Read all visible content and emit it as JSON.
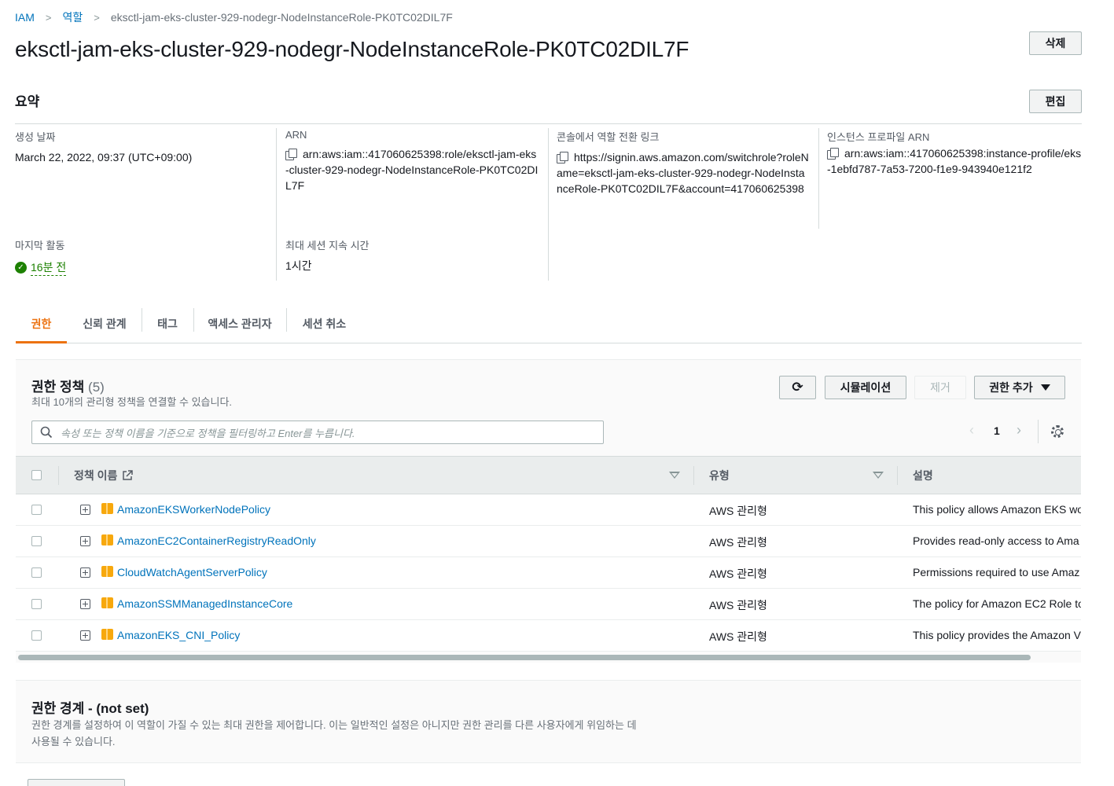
{
  "breadcrumb": {
    "root": "IAM",
    "section": "역할",
    "current": "eksctl-jam-eks-cluster-929-nodegr-NodeInstanceRole-PK0TC02DIL7F"
  },
  "title": "eksctl-jam-eks-cluster-929-nodegr-NodeInstanceRole-PK0TC02DIL7F",
  "buttons": {
    "delete": "삭제",
    "edit": "편집"
  },
  "summary": {
    "heading": "요약",
    "created_label": "생성 날짜",
    "created_value": "March 22, 2022, 09:37 (UTC+09:00)",
    "arn_label": "ARN",
    "arn_value": "arn:aws:iam::417060625398:role/eksctl-jam-eks-cluster-929-nodegr-NodeInstanceRole-PK0TC02DIL7F",
    "switch_label": "콘솔에서 역할 전환 링크",
    "switch_value": "https://signin.aws.amazon.com/switchrole?roleName=eksctl-jam-eks-cluster-929-nodegr-NodeInstanceRole-PK0TC02DIL7F&account=417060625398",
    "profile_label": "인스턴스 프로파일 ARN",
    "profile_value": "arn:aws:iam::417060625398:instance-profile/eks-1ebfd787-7a53-7200-f1e9-943940e121f2",
    "last_activity_label": "마지막 활동",
    "last_activity_value": "16분 전",
    "max_session_label": "최대 세션 지속 시간",
    "max_session_value": "1시간"
  },
  "tabs": [
    "권한",
    "신뢰 관계",
    "태그",
    "액세스 관리자",
    "세션 취소"
  ],
  "permissions": {
    "title": "권한 정책",
    "count": "(5)",
    "description": "최대 10개의 관리형 정책을 연결할 수 있습니다.",
    "simulate": "시뮬레이션",
    "remove": "제거",
    "add": "권한 추가",
    "search_placeholder": "속성 또는 정책 이름을 기준으로 정책을 필터링하고 Enter를 누릅니다.",
    "page": "1",
    "columns": {
      "name": "정책 이름",
      "type": "유형",
      "desc": "설명"
    },
    "rows": [
      {
        "name": "AmazonEKSWorkerNodePolicy",
        "type": "AWS 관리형",
        "desc": "This policy allows Amazon EKS wo"
      },
      {
        "name": "AmazonEC2ContainerRegistryReadOnly",
        "type": "AWS 관리형",
        "desc": "Provides read-only access to Ama"
      },
      {
        "name": "CloudWatchAgentServerPolicy",
        "type": "AWS 관리형",
        "desc": "Permissions required to use Amaz"
      },
      {
        "name": "AmazonSSMManagedInstanceCore",
        "type": "AWS 관리형",
        "desc": "The policy for Amazon EC2 Role to"
      },
      {
        "name": "AmazonEKS_CNI_Policy",
        "type": "AWS 관리형",
        "desc": "This policy provides the Amazon V"
      }
    ]
  },
  "boundary": {
    "title": "권한 경계 - (not set)",
    "description": "권한 경계를 설정하여 이 역할이 가질 수 있는 최대 권한을 제어합니다. 이는 일반적인 설정은 아니지만 권한 관리를 다른 사용자에게 위임하는 데 사용될 수 있습니다."
  },
  "colors": {
    "link": "#0073bb",
    "accent": "#ec7211",
    "success": "#1d8102"
  }
}
